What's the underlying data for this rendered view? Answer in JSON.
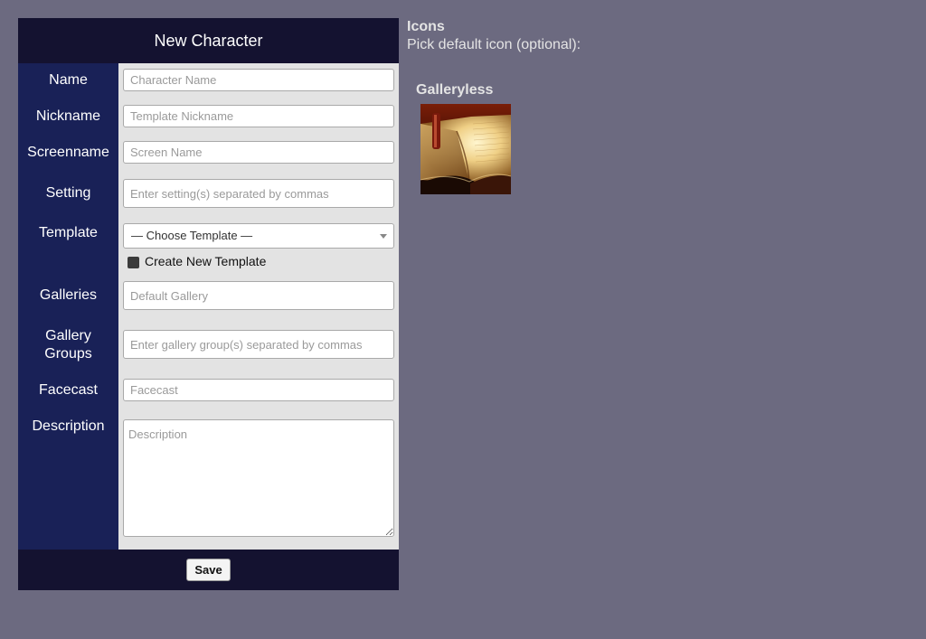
{
  "form": {
    "title": "New Character",
    "fields": {
      "name": {
        "label": "Name",
        "placeholder": "Character Name"
      },
      "nickname": {
        "label": "Nickname",
        "placeholder": "Template Nickname"
      },
      "screenname": {
        "label": "Screenname",
        "placeholder": "Screen Name"
      },
      "setting": {
        "label": "Setting",
        "placeholder": "Enter setting(s) separated by commas"
      },
      "template": {
        "label": "Template",
        "selected": "— Choose Template —",
        "checkbox_label": "Create New Template"
      },
      "galleries": {
        "label": "Galleries",
        "placeholder": "Default Gallery"
      },
      "gallery_groups": {
        "label_line1": "Gallery",
        "label_line2": "Groups",
        "placeholder": "Enter gallery group(s) separated by commas"
      },
      "facecast": {
        "label": "Facecast",
        "placeholder": "Facecast"
      },
      "description": {
        "label": "Description",
        "placeholder": "Description"
      }
    },
    "save_label": "Save"
  },
  "icons": {
    "title": "Icons",
    "subtitle": "Pick default icon (optional):",
    "gallery_name": "Galleryless",
    "icon_name": "book-icon"
  },
  "colors": {
    "page_bg": "#6c6a80",
    "header_bg": "#141230",
    "label_bg": "#192157",
    "field_bg": "#e3e3e3"
  }
}
